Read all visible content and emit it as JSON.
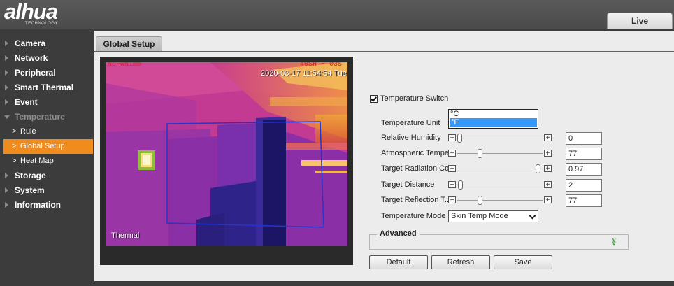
{
  "header": {
    "logo_text": "alhua",
    "logo_sub": "TECHNOLOGY",
    "live_tab": "Live"
  },
  "sidebar": {
    "items": [
      {
        "label": "Camera"
      },
      {
        "label": "Network"
      },
      {
        "label": "Peripheral"
      },
      {
        "label": "Smart Thermal"
      },
      {
        "label": "Event"
      },
      {
        "label": "Temperature",
        "expanded": true
      },
      {
        "label": "Rule"
      },
      {
        "label": "Global Setup",
        "active": true
      },
      {
        "label": "Heat Map"
      },
      {
        "label": "Storage"
      },
      {
        "label": "System"
      },
      {
        "label": "Information"
      }
    ]
  },
  "main": {
    "tab": "Global Setup",
    "video": {
      "osd_left": "NoFWNimm",
      "osd_right": "40SH ~ 03S",
      "timestamp": "2020-03-17 11:54:54 Tue",
      "channel": "Thermal"
    },
    "form": {
      "temperature_switch": {
        "label": "Temperature Switch",
        "checked": true
      },
      "temperature_unit": {
        "label": "Temperature Unit",
        "options": [
          "°C",
          "°F"
        ],
        "selected": "°F"
      },
      "relative_humidity": {
        "label": "Relative Humidity",
        "value": "0",
        "slider_fraction": 0.0
      },
      "atmospheric_temperature": {
        "label": "Atmospheric Tempe...",
        "value": "77",
        "slider_fraction": 0.25
      },
      "target_radiation": {
        "label": "Target Radiation Co...",
        "value": "0.97",
        "slider_fraction": 0.97
      },
      "target_distance": {
        "label": "Target Distance",
        "value": "2",
        "slider_fraction": 0.01
      },
      "target_reflection": {
        "label": "Target Reflection T...",
        "value": "77",
        "slider_fraction": 0.25
      },
      "temperature_mode": {
        "label": "Temperature Mode",
        "value": "Skin Temp Mode"
      },
      "advanced": {
        "label": "Advanced"
      }
    },
    "buttons": {
      "default": "Default",
      "refresh": "Refresh",
      "save": "Save"
    }
  },
  "colors": {
    "accent": "#f08c1e",
    "selection": "#3399ff",
    "sidebar_bg": "#3c3c3c"
  }
}
